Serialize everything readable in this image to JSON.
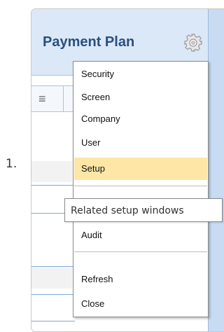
{
  "step_number": "1.",
  "window": {
    "title": "Payment Plan",
    "settings_icon": "gear-icon",
    "grid_menu_icon": "hamburger-icon"
  },
  "menu": {
    "items": [
      "Security",
      "Screen",
      "Company",
      "User",
      "Setup",
      "Audit",
      "Refresh",
      "Close"
    ],
    "selected": "Setup",
    "highlight_color": "#fde6a6"
  },
  "tooltip": {
    "text": "Related setup windows"
  },
  "colors": {
    "title_text": "#2a4f7e",
    "title_bar": "#dbe8f8",
    "side_strip": "#c7dbf3"
  }
}
